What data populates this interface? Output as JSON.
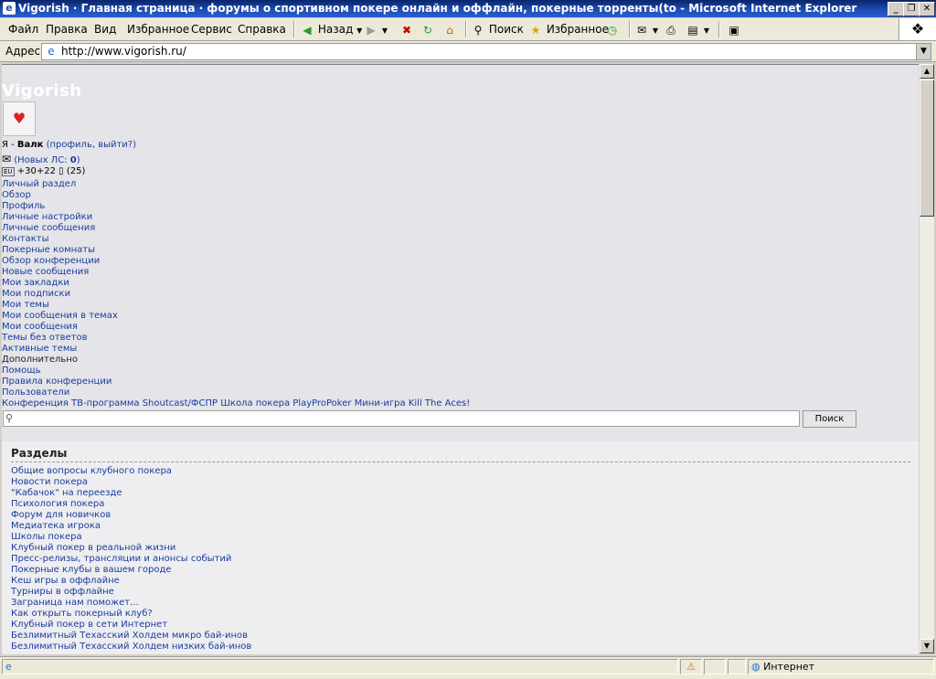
{
  "window": {
    "title": "Vigorish · Главная страница · форумы о спортивном покере онлайн и оффлайн, покерные торренты(to - Microsoft Internet Explorer"
  },
  "menu": [
    "Файл",
    "Правка",
    "Вид",
    "Избранное",
    "Сервис",
    "Справка"
  ],
  "toolbar": {
    "back": "Назад",
    "search": "Поиск",
    "favorites": "Избранное"
  },
  "address": {
    "label": "Адрес:",
    "url": "http://www.vigorish.ru/"
  },
  "site": {
    "logo": "Vigorish",
    "user_prefix": "Я - ",
    "username": "Валк",
    "user_links": "(профиль, выйти?)",
    "pm_text": "(Новых ЛС: ",
    "pm_count": "0",
    "pm_close": ")",
    "rep_text": "+30+22",
    "rep_count": "(25)",
    "nav": [
      "Личный раздел",
      "Обзор",
      "Профиль",
      "Личные настройки",
      "Личные сообщения",
      "Контакты",
      "Покерные комнаты",
      "Обзор конференции",
      "Новые сообщения",
      "Мои закладки",
      "Мои подписки",
      "Мои темы",
      "Мои сообщения в темах",
      "Мои сообщения",
      "Темы без ответов",
      "Активные темы",
      "Дополнительно",
      "Помощь",
      "Правила конференции",
      "Пользователи",
      "Конференция ТВ-программа Shoutcast/ФСПР Школа покера PlayProPoker Мини-игра Kill The Aces!"
    ],
    "search_button": "Поиск",
    "sections_title": "Разделы",
    "sections": [
      "Общие вопросы клубного покера",
      "Новости покера",
      "\"Кабачок\" на переезде",
      "Психология покера",
      "Форум для новичков",
      "Медиатека игрока",
      "Школы покера",
      "Клубный покер в реальной жизни",
      "Пресс-релизы, трансляции и анонсы событий",
      "Покерные клубы в вашем городе",
      "Кеш игры в оффлайне",
      "Турниры в оффлайне",
      "Заграница нам поможет...",
      "Как открыть покерный клуб?",
      "Клубный покер в сети Интернет",
      "Безлимитный Техасский Холдем микро бай-инов",
      "Безлимитный Техасский Холдем низких бай-инов"
    ]
  },
  "status": {
    "zone": "Интернет"
  }
}
